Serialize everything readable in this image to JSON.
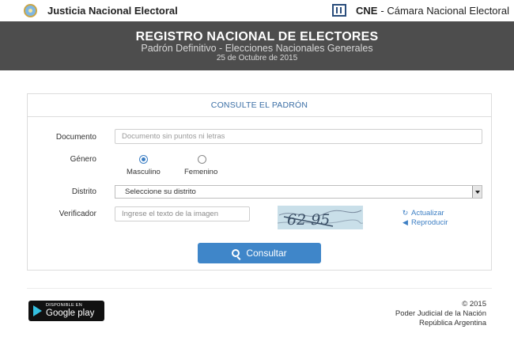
{
  "header": {
    "left_title": "Justicia Nacional Electoral",
    "right_brand": "CNE",
    "right_title": "- Cámara Nacional Electoral"
  },
  "banner": {
    "title": "REGISTRO NACIONAL DE ELECTORES",
    "subtitle": "Padrón Definitivo - Elecciones Nacionales Generales",
    "date": "25 de Octubre de 2015"
  },
  "form": {
    "heading": "CONSULTE EL PADRÓN",
    "documento_label": "Documento",
    "documento_placeholder": "Documento sin puntos ni letras",
    "genero_label": "Género",
    "masculino_label": "Masculino",
    "femenino_label": "Femenino",
    "genero_selected": "Masculino",
    "distrito_label": "Distrito",
    "distrito_selected": "Seleccione su distrito",
    "verificador_label": "Verificador",
    "verificador_placeholder": "Ingrese el texto de la imagen",
    "captcha_text": "62 95",
    "actualizar_label": "Actualizar",
    "reproducir_label": "Reproducir",
    "submit_label": "Consultar"
  },
  "footer": {
    "store_small": "DISPONIBLE EN",
    "store_big": "Google play",
    "copyright": "© 2015",
    "org1": "Poder Judicial de la Nación",
    "org2": "República Argentina"
  },
  "colors": {
    "banner_bg": "#4d4d4d",
    "accent": "#3f86c9",
    "heading_text": "#3a6ea5"
  }
}
